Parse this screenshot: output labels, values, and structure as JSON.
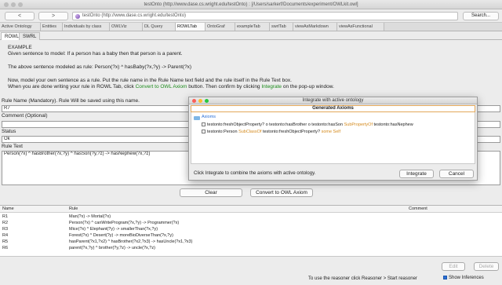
{
  "window": {
    "title": "testOnto (http://www.dase.cs.wright.edu/testOnto) : [/Users/sarkerf/Documents/experiment/OWLkit.owl]"
  },
  "toolbar": {
    "back_label": "<",
    "forward_label": ">",
    "url_text": "testOnto (http://www.dase.cs.wright.edu/testOnto)",
    "search_label": "Search..."
  },
  "tabs": [
    {
      "label": "Active Ontology"
    },
    {
      "label": "Entities"
    },
    {
      "label": "Individuals by class"
    },
    {
      "label": "OWLViz"
    },
    {
      "label": "DL Query"
    },
    {
      "label": "ROWLTab"
    },
    {
      "label": "OntoGraf"
    },
    {
      "label": "exampleTab"
    },
    {
      "label": "swrlTab"
    },
    {
      "label": "viewAsMarkdown"
    },
    {
      "label": "viewAsFunctional"
    }
  ],
  "subtabs": [
    {
      "label": "ROWL"
    },
    {
      "label": "SWRL"
    }
  ],
  "instructions": {
    "example_heading": "EXAMPLE",
    "line1": "Given sentence to model: If a person has a baby then that person is a parent.",
    "line2": "The above sentence modeled as rule: Person(?x) ^ hasBaby(?x,?y) -> Parent(?x)",
    "line3": "Now, model your own sentence as a rule. Put the rule name in the Rule Name text field and the rule itself in the Rule Text box.",
    "line4_a": "When you are done writing your rule in ROWL Tab, click",
    "line4_b": "Convert to OWL Axiom",
    "line4_c": "button. Then confirm by clicking",
    "line4_d": "Integrate",
    "line4_e": "on the pop-up window."
  },
  "form": {
    "rule_name_label": "Rule Name (Mandatory). Rule Will be saved using this name.",
    "rule_name_value": "R7",
    "comment_label": "Comment (Optional)",
    "comment_value": "",
    "status_label": "Status",
    "status_value": "Ok",
    "rule_text_label": "Rule Text",
    "rule_text_value": "Person(?x) ^ hasBrother(?x,?y) ^ hasSon(?y,?z) -> hasNephew(?x,?z)",
    "clear_label": "Clear",
    "convert_label": "Convert to OWL Axiom"
  },
  "table": {
    "headers": [
      "Name",
      "Rule",
      "Comment"
    ],
    "rows": [
      {
        "name": "R1",
        "rule": "Man(?x) -> Mortal(?x)",
        "comment": ""
      },
      {
        "name": "R2",
        "rule": "Person(?x) ^ canWriteProgram(?x,?y) -> Programmer(?x)",
        "comment": ""
      },
      {
        "name": "R3",
        "rule": "Mice(?x) ^ Elephant(?y) -> smallerThan(?x,?y)",
        "comment": ""
      },
      {
        "name": "R4",
        "rule": "Forest(?x) ^ Desert(?y) -> moreBioDiverseThan(?x,?y)",
        "comment": ""
      },
      {
        "name": "R5",
        "rule": "hasParent(?x1,?x2) ^ hasBrother(?x2,?x3) -> hasUncle(?x1,?x3)",
        "comment": ""
      },
      {
        "name": "R6",
        "rule": "parent(?x,?y) ^ brother(?y,?z) -> uncle(?x,?z)",
        "comment": ""
      }
    ]
  },
  "bottom": {
    "edit_label": "Edit",
    "delete_label": "Delete",
    "reasoner_hint": "To use the reasoner click Reasoner > Start reasoner",
    "show_inferences_label": "Show Inferences"
  },
  "dialog": {
    "title": "Integrate with active ontology",
    "header": "Generated Axioms",
    "root_label": "Axioms",
    "axiom1": "testonto:freshObjectProperty? o testonto:hasBrother o testonto:hasSon SubPropertyOf testonto:hasNephew",
    "axiom1_a": "testonto:freshObjectProperty? o testonto:hasBrother o testonto:hasSon",
    "axiom1_kw": "SubPropertyOf",
    "axiom1_b": "testonto:hasNephew",
    "axiom2_a": "testonto:Person",
    "axiom2_kw1": "SubClassOf",
    "axiom2_b": "testonto:freshObjectProperty?",
    "axiom2_kw2": "some Self",
    "footer_hint": "Click Integrate to combine the axioms with active ontology.",
    "integrate_label": "Integrate",
    "cancel_label": "Cancel"
  },
  "colors": {
    "accent_green": "#1a8a1a",
    "keyword_orange": "#d48a1e",
    "selection_blue": "#2a6fd6"
  }
}
